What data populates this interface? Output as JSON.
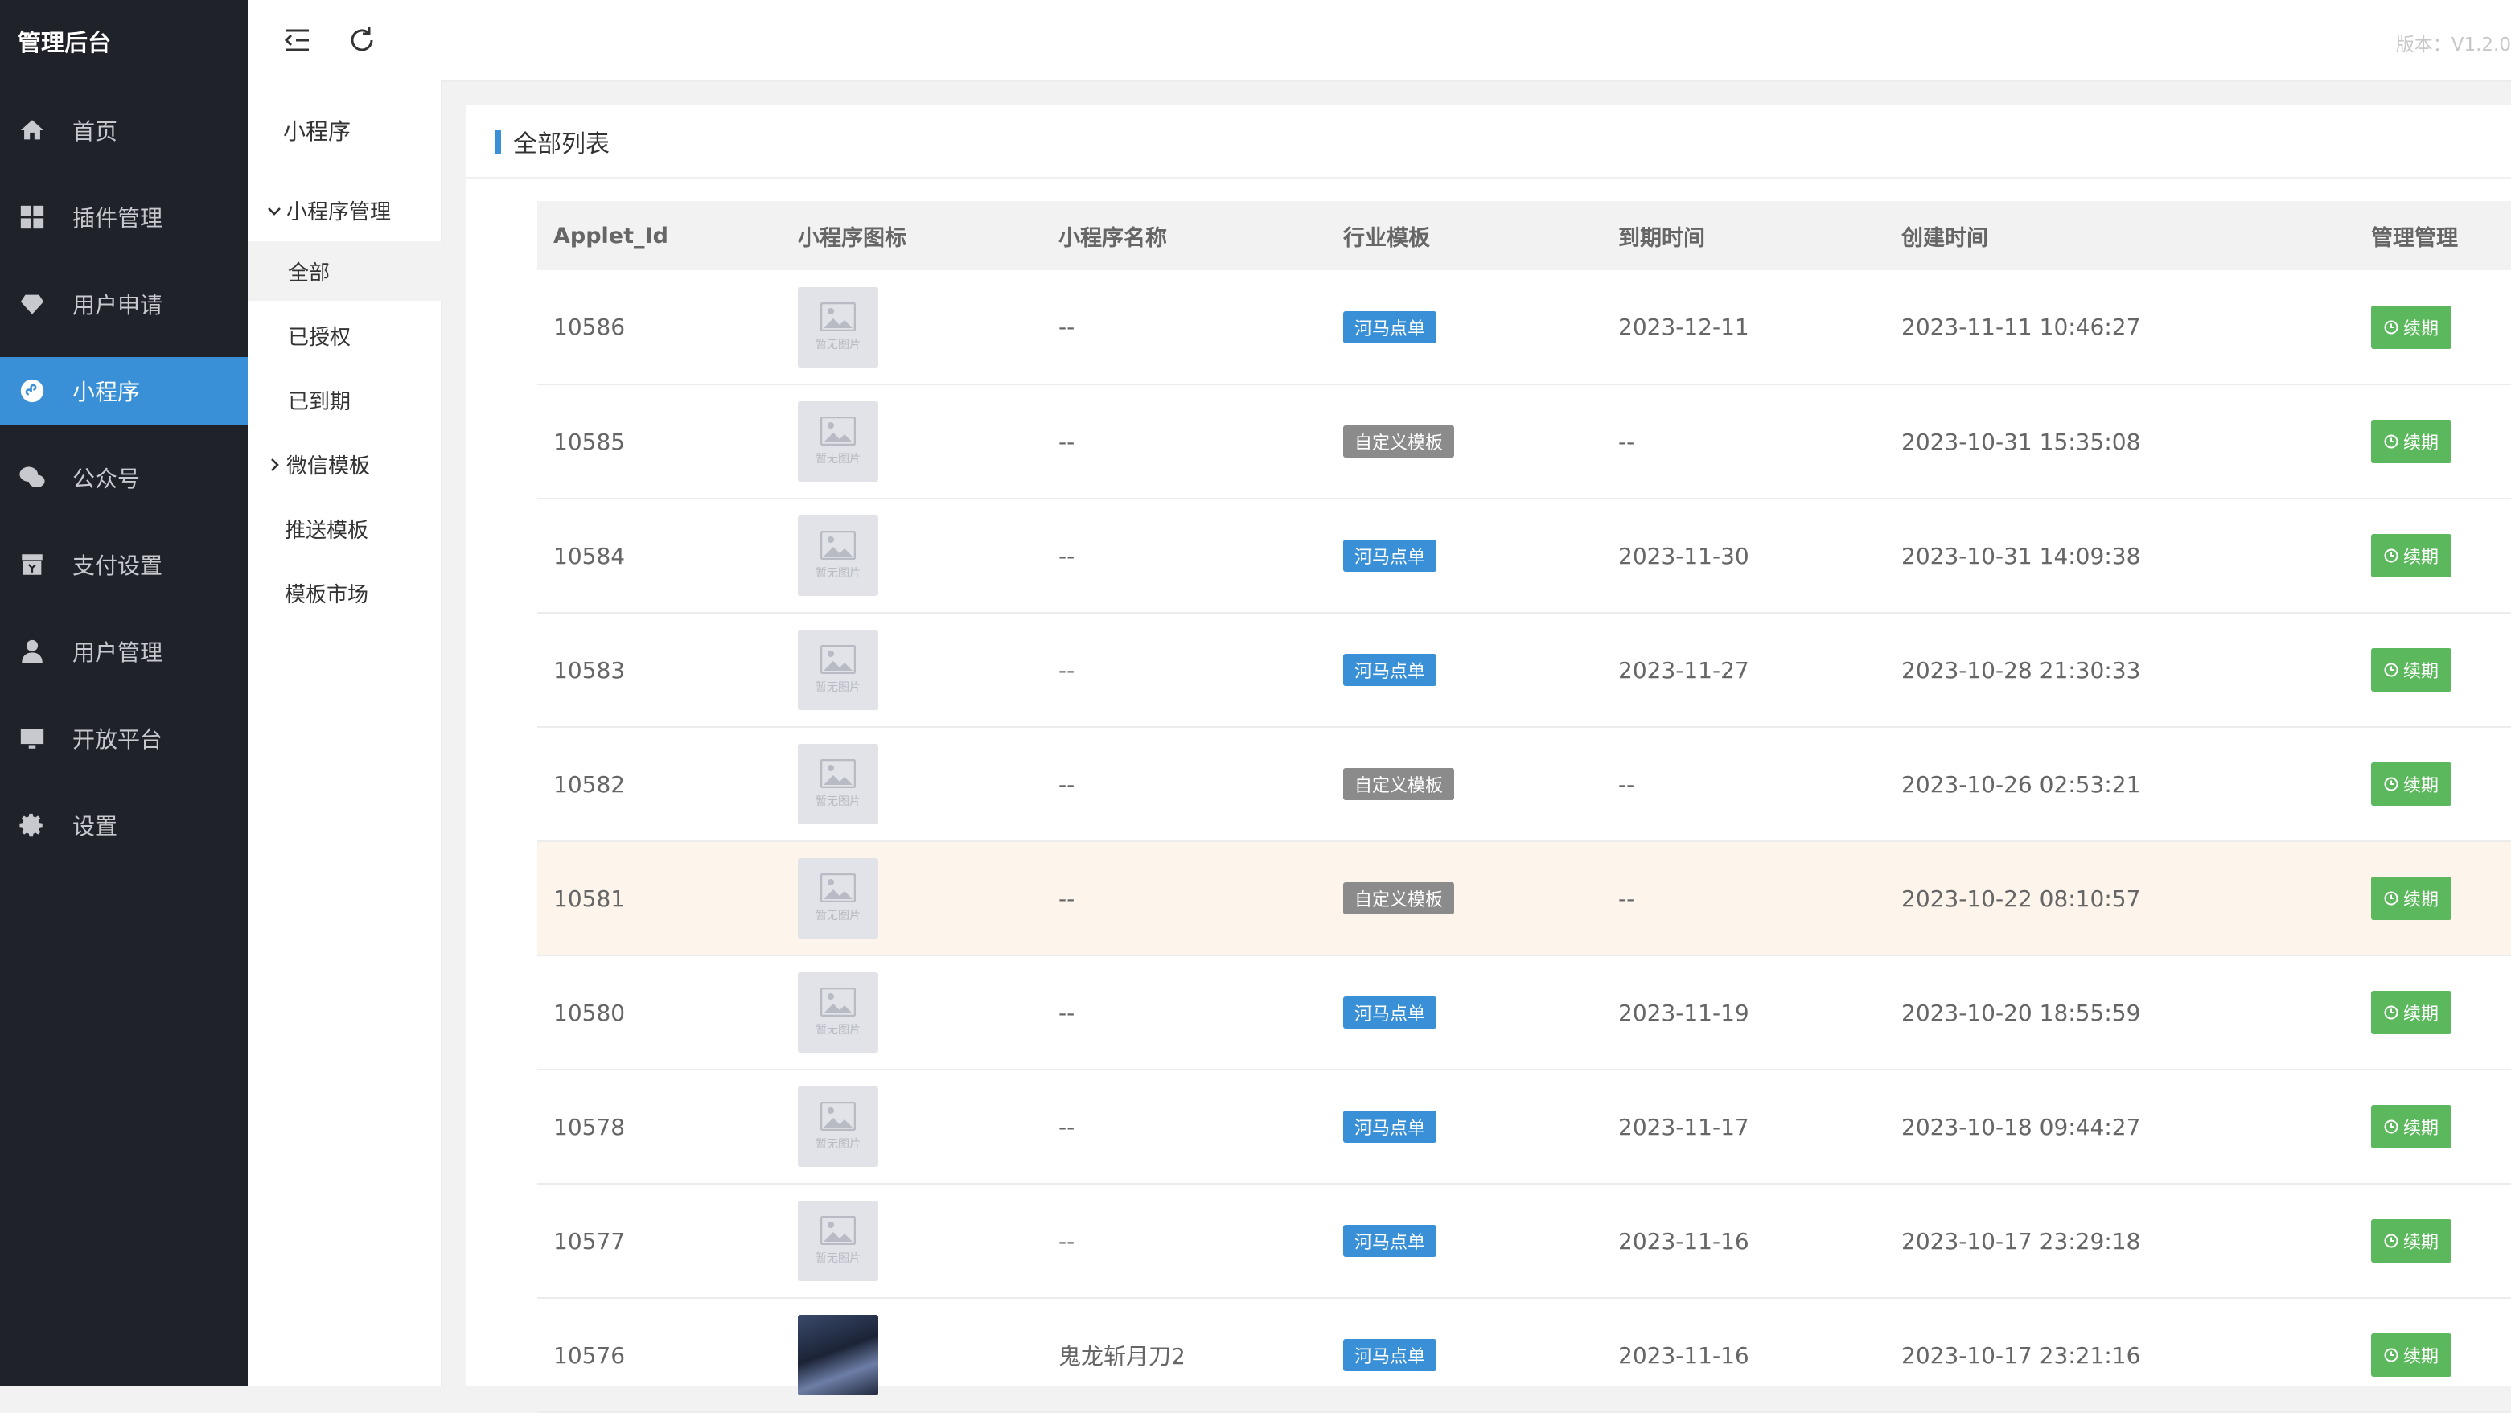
{
  "brand": "管理后台",
  "version": "版本：V1.2.0",
  "nav": [
    {
      "label": "首页",
      "icon": "home-icon"
    },
    {
      "label": "插件管理",
      "icon": "grid-icon"
    },
    {
      "label": "用户申请",
      "icon": "diamond-icon"
    },
    {
      "label": "小程序",
      "icon": "mini-program-icon"
    },
    {
      "label": "公众号",
      "icon": "wechat-icon"
    },
    {
      "label": "支付设置",
      "icon": "payment-icon"
    },
    {
      "label": "用户管理",
      "icon": "user-icon"
    },
    {
      "label": "开放平台",
      "icon": "monitor-icon"
    },
    {
      "label": "设置",
      "icon": "gear-icon"
    }
  ],
  "subnav": {
    "title": "小程序",
    "group1": "小程序管理",
    "children": [
      "全部",
      "已授权",
      "已到期"
    ],
    "group2": "微信模板",
    "extra": [
      "推送模板",
      "模板市场"
    ]
  },
  "card": {
    "title": "全部列表",
    "columns": [
      "Applet_Id",
      "小程序图标",
      "小程序名称",
      "行业模板",
      "到期时间",
      "创建时间",
      "管理管理"
    ],
    "placeholder": "暂无图片",
    "renew_label": "续期",
    "rows": [
      {
        "id": "10586",
        "name": "--",
        "template": "河马点单",
        "tpl_type": "blue",
        "expire": "2023-12-11",
        "created": "2023-11-11 10:46:27"
      },
      {
        "id": "10585",
        "name": "--",
        "template": "自定义模板",
        "tpl_type": "gray",
        "expire": "--",
        "created": "2023-10-31 15:35:08"
      },
      {
        "id": "10584",
        "name": "--",
        "template": "河马点单",
        "tpl_type": "blue",
        "expire": "2023-11-30",
        "created": "2023-10-31 14:09:38"
      },
      {
        "id": "10583",
        "name": "--",
        "template": "河马点单",
        "tpl_type": "blue",
        "expire": "2023-11-27",
        "created": "2023-10-28 21:30:33"
      },
      {
        "id": "10582",
        "name": "--",
        "template": "自定义模板",
        "tpl_type": "gray",
        "expire": "--",
        "created": "2023-10-26 02:53:21"
      },
      {
        "id": "10581",
        "name": "--",
        "template": "自定义模板",
        "tpl_type": "gray",
        "expire": "--",
        "created": "2023-10-22 08:10:57"
      },
      {
        "id": "10580",
        "name": "--",
        "template": "河马点单",
        "tpl_type": "blue",
        "expire": "2023-11-19",
        "created": "2023-10-20 18:55:59"
      },
      {
        "id": "10578",
        "name": "--",
        "template": "河马点单",
        "tpl_type": "blue",
        "expire": "2023-11-17",
        "created": "2023-10-18 09:44:27"
      },
      {
        "id": "10577",
        "name": "--",
        "template": "河马点单",
        "tpl_type": "blue",
        "expire": "2023-11-16",
        "created": "2023-10-17 23:29:18"
      },
      {
        "id": "10576",
        "name": "鬼龙斩月刀2",
        "template": "河马点单",
        "tpl_type": "blue",
        "expire": "2023-11-16",
        "created": "2023-10-17 23:21:16",
        "photo": true
      }
    ]
  }
}
